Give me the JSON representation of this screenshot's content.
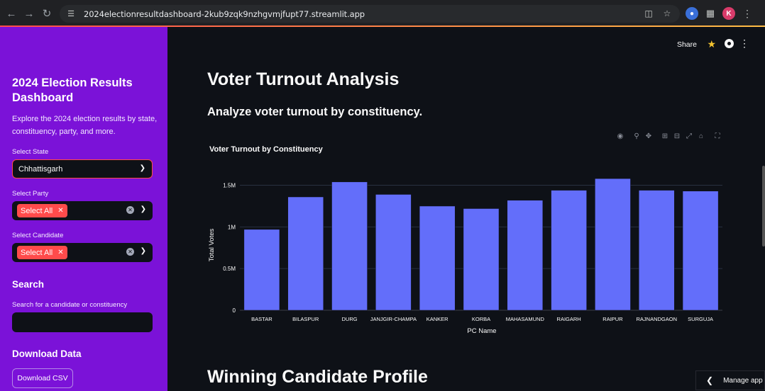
{
  "browser": {
    "url": "2024electionresultdashboard-2kub9zqk9nzhgvmjfupt77.streamlit.app",
    "profile_initial": "K"
  },
  "sidebar": {
    "title": "2024 Election Results Dashboard",
    "description": "Explore the 2024 election results by state, constituency, party, and more.",
    "state_label": "Select State",
    "state_value": "Chhattisgarh",
    "party_label": "Select Party",
    "party_tag": "Select All",
    "candidate_label": "Select Candidate",
    "candidate_tag": "Select All",
    "search_heading": "Search",
    "search_label": "Search for a candidate or constituency",
    "search_value": "",
    "download_heading": "Download Data",
    "download_button": "Download CSV"
  },
  "header": {
    "share_label": "Share"
  },
  "main": {
    "title": "Voter Turnout Analysis",
    "subtitle": "Analyze voter turnout by constituency.",
    "next_section_title": "Winning Candidate Profile",
    "manage_app": "Manage app"
  },
  "colors": {
    "sidebar_bg": "#7b12d8",
    "accent": "#ff4b4b",
    "bar": "#636efa"
  },
  "chart_data": {
    "type": "bar",
    "title": "Voter Turnout by Constituency",
    "xlabel": "PC Name",
    "ylabel": "Total Votes",
    "categories": [
      "BASTAR",
      "BILASPUR",
      "DURG",
      "JANJGIR-CHAMPA",
      "KANKER",
      "KORBA",
      "MAHASAMUND",
      "RAIGARH",
      "RAIPUR",
      "RAJNANDGAON",
      "SURGUJA"
    ],
    "values": [
      970000,
      1360000,
      1540000,
      1390000,
      1250000,
      1220000,
      1320000,
      1440000,
      1580000,
      1440000,
      1430000
    ],
    "ylim": [
      0,
      1500000
    ],
    "yticks": [
      0,
      500000,
      1000000,
      1500000
    ],
    "ytick_labels": [
      "0",
      "0.5M",
      "1M",
      "1.5M"
    ],
    "grid": true
  }
}
